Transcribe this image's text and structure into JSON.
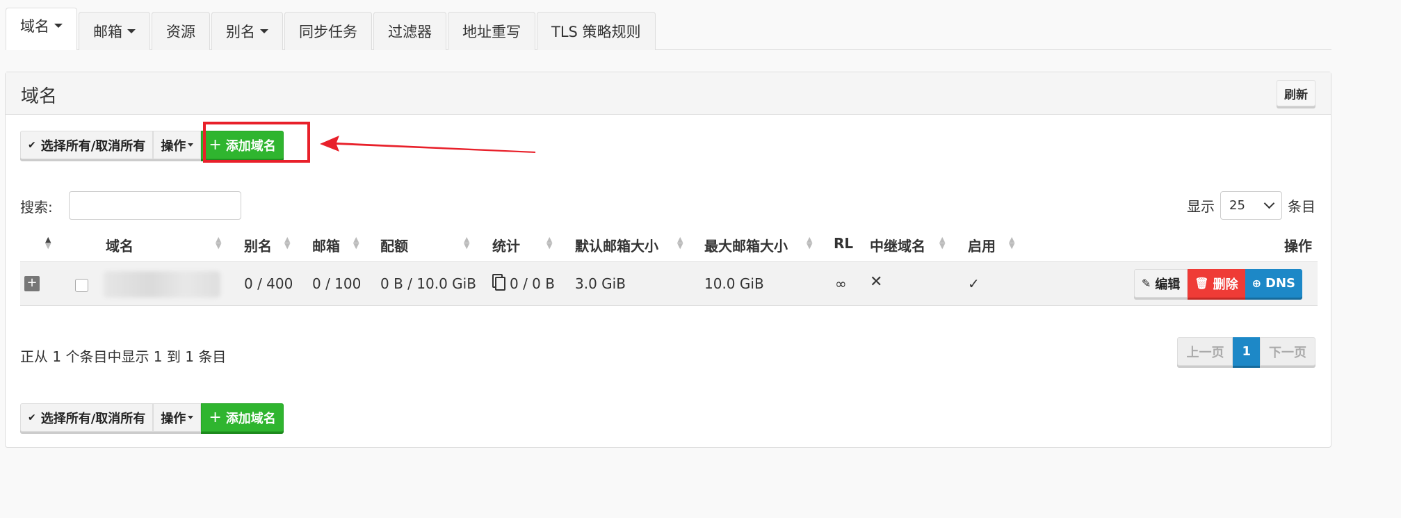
{
  "tabs": [
    {
      "label": "域名",
      "dropdown": true,
      "active": true
    },
    {
      "label": "邮箱",
      "dropdown": true
    },
    {
      "label": "资源",
      "dropdown": false
    },
    {
      "label": "别名",
      "dropdown": true
    },
    {
      "label": "同步任务",
      "dropdown": false
    },
    {
      "label": "过滤器",
      "dropdown": false
    },
    {
      "label": "地址重写",
      "dropdown": false
    },
    {
      "label": "TLS 策略规则",
      "dropdown": false
    }
  ],
  "panel": {
    "title": "域名",
    "refresh_label": "刷新"
  },
  "toolbar": {
    "select_all_label": "选择所有/取消所有",
    "actions_label": "操作",
    "add_domain_label": "添加域名"
  },
  "search": {
    "label": "搜索:",
    "value": ""
  },
  "length": {
    "prefix": "显示",
    "value": "25",
    "suffix": "条目"
  },
  "table": {
    "headers": {
      "domain": "域名",
      "aliases": "别名",
      "mailboxes": "邮箱",
      "quota": "配额",
      "stats": "统计",
      "default_mailbox_size": "默认邮箱大小",
      "max_mailbox_size": "最大邮箱大小",
      "rl": "RL",
      "relay_domain": "中继域名",
      "active": "启用",
      "actions": "操作"
    },
    "rows": [
      {
        "expand": "+",
        "domain": "",
        "aliases": "0 / 400",
        "mailboxes": "0 / 100",
        "quota": "0 B / 10.0 GiB",
        "stats": "0 / 0 B",
        "default_mailbox_size": "3.0 GiB",
        "max_mailbox_size": "10.0 GiB",
        "rl": "∞",
        "relay_domain": "✕",
        "active": "✓",
        "edit_label": "编辑",
        "delete_label": "删除",
        "dns_label": "DNS"
      }
    ]
  },
  "info": "正从 1 个条目中显示 1 到 1 条目",
  "pagination": {
    "prev": "上一页",
    "current": "1",
    "next": "下一页"
  },
  "colors": {
    "add_green": "#2fb52f",
    "delete_red": "#ef3b36",
    "dns_blue": "#1d88c7",
    "highlight_red": "#e8202a"
  }
}
